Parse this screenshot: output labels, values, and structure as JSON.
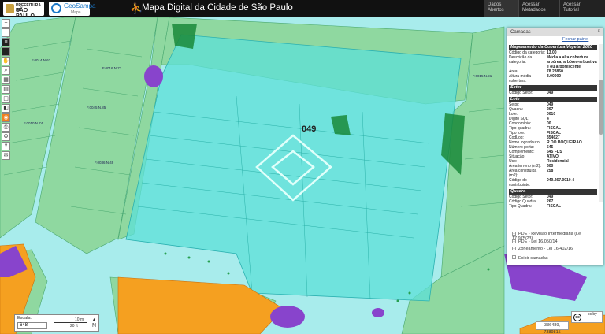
{
  "header": {
    "pref_line1": "PREFEITURA DE",
    "pref_line2": "SÃO PAULO",
    "geo_line1": "GeoSampa",
    "geo_line2": "Mapa",
    "title": "Mapa Digital da Cidade de São Paulo",
    "buttons": [
      {
        "line1": "Dados",
        "line2": "Abertos"
      },
      {
        "line1": "Acessar",
        "line2": "Metadados"
      },
      {
        "line1": "Acessar",
        "line2": "Tutorial"
      }
    ]
  },
  "toolbar": {
    "icons": [
      "plus-icon",
      "minus-icon",
      "layers-icon",
      "info-icon",
      "hand-icon",
      "search-icon",
      "measure-icon",
      "save-icon",
      "print-icon",
      "coordinate-icon",
      "rss-icon",
      "printer-icon",
      "settings-icon",
      "share-icon",
      "mail-icon"
    ],
    "glyphs": [
      "+",
      "−",
      "≡",
      "i",
      "✋",
      "⌕",
      "▦",
      "▤",
      "◫",
      "◧",
      "◉",
      "⎙",
      "⚙",
      "⇪",
      "✉"
    ]
  },
  "map": {
    "setor_label": "049",
    "colors": {
      "lot_green": "#8fd8a0",
      "selection_cyan": "#5ce0d8",
      "road": "#9fe8e8",
      "orange": "#f5a020",
      "purple": "#8844cc",
      "dark_green": "#1a8a3a"
    },
    "lot_labels": [
      "F.0014 N.62",
      "F.0016 N.73",
      "F.0045 N.85",
      "F.0010 N.74",
      "F.0015 N.91",
      "F.0036 N.49"
    ]
  },
  "panel": {
    "title": "Camadas",
    "close_label": "Fechar painel",
    "sections": [
      {
        "heading": "Mapeamento da Cobertura Vegetal 2020",
        "rows": [
          {
            "k": "Código da categoria:",
            "v": "13.00"
          },
          {
            "k": "Descrição da categoria:",
            "v": "Média a alta cobertura arbórea, arbóreo-arbustiva e ou arborescente"
          },
          {
            "k": "Área:",
            "v": "78.23860"
          },
          {
            "k": "Altura média cobertura:",
            "v": "3.00000"
          }
        ]
      },
      {
        "heading": "Setor",
        "rows": [
          {
            "k": "Código Setor:",
            "v": "049"
          }
        ]
      },
      {
        "heading": "Lote",
        "rows": [
          {
            "k": "Setor:",
            "v": "049"
          },
          {
            "k": "Quadra:",
            "v": "267"
          },
          {
            "k": "Lote:",
            "v": "0010"
          },
          {
            "k": "Dígito SQL:",
            "v": "4"
          },
          {
            "k": "Condomínio:",
            "v": "00"
          },
          {
            "k": "Tipo quadra:",
            "v": "FISCAL"
          },
          {
            "k": "Tipo lote:",
            "v": "FISCAL"
          },
          {
            "k": "CodLog:",
            "v": "354627"
          },
          {
            "k": "Nome logradouro:",
            "v": "R DO BOQUEIRAO"
          },
          {
            "k": "Número porta:",
            "v": "545"
          },
          {
            "k": "Complemento:",
            "v": "545 FDS"
          },
          {
            "k": "Situação:",
            "v": "ATIVO"
          },
          {
            "k": "Uso:",
            "v": "Residencial"
          },
          {
            "k": "Área terreno (m2):",
            "v": "600"
          },
          {
            "k": "Área construída (m2):",
            "v": "258"
          },
          {
            "k": "Código do contribuinte:",
            "v": "049.267.0010-4"
          }
        ]
      },
      {
        "heading": "Quadra",
        "rows": [
          {
            "k": "Código Setor:",
            "v": "049"
          },
          {
            "k": "Código Quadra:",
            "v": "267"
          },
          {
            "k": "Tipo Quadra:",
            "v": "FISCAL"
          }
        ]
      }
    ],
    "layers": [
      "PDE - Revisão Intermediária (Lei 17.975/23)",
      "PDE - Lei 16.050/14",
      "Zoneamento - Lei 16.402/16"
    ],
    "exibir_label": "Exibir camadas"
  },
  "scale": {
    "label": "Escala:",
    "value": "648",
    "bar_m": "10 m",
    "bar_ft": "20 ft",
    "north": "N"
  },
  "coords": "336489, 7389815",
  "license": "cc by"
}
